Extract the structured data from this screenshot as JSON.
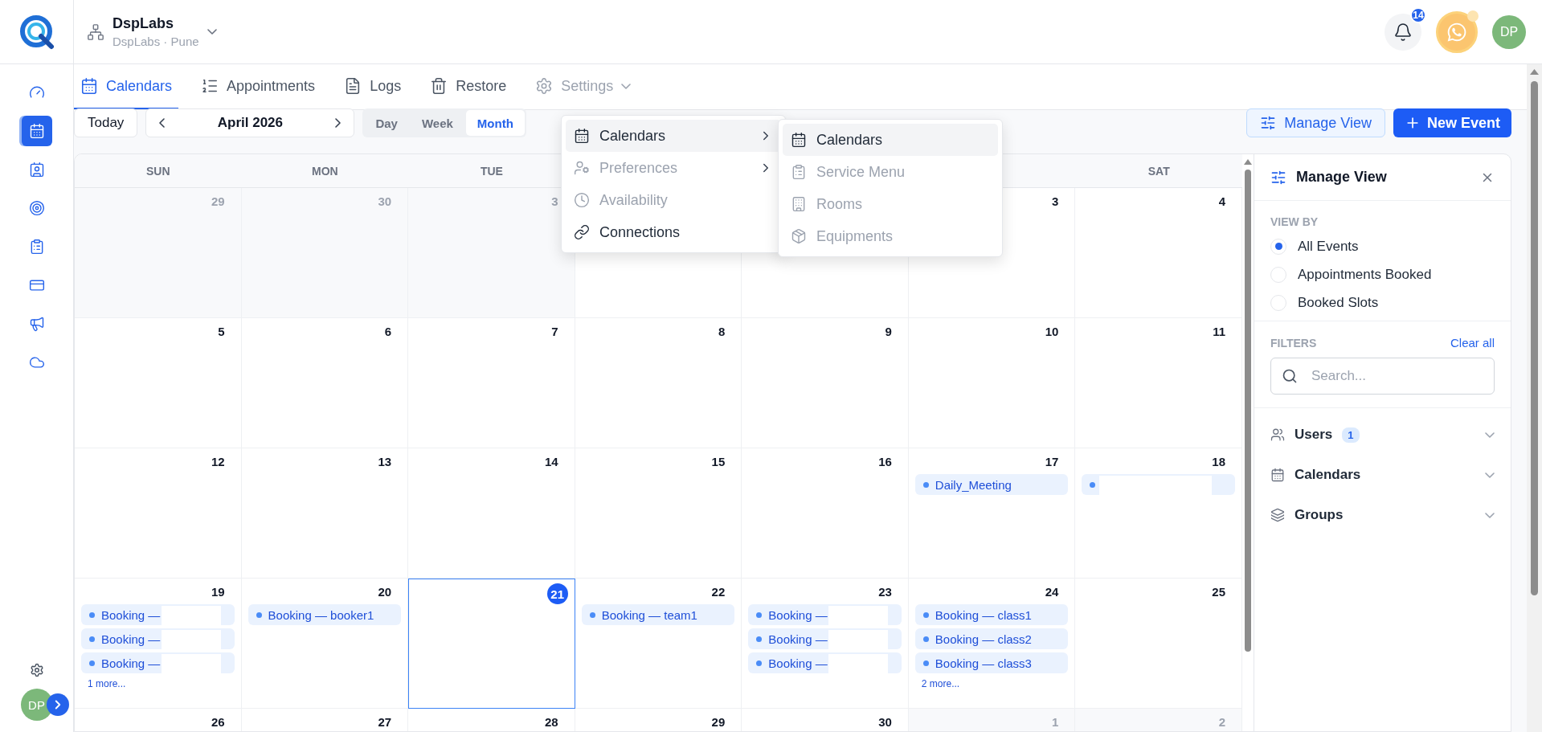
{
  "brand": {
    "org": "DspLabs",
    "location": "DspLabs · Pune"
  },
  "header": {
    "notification_count": "14",
    "avatar": "DP"
  },
  "sidebar": {
    "items": [
      {
        "kind": "gauge",
        "selected": false
      },
      {
        "kind": "calendar",
        "selected": true
      },
      {
        "kind": "contacts",
        "selected": false
      },
      {
        "kind": "target",
        "selected": false
      },
      {
        "kind": "clipboard",
        "selected": false
      },
      {
        "kind": "card",
        "selected": false
      },
      {
        "kind": "megaphone",
        "selected": false
      },
      {
        "kind": "cloud",
        "selected": false
      }
    ],
    "avatar": "DP"
  },
  "tabs": [
    {
      "label": "Calendars",
      "kind": "calendar",
      "selected": true
    },
    {
      "label": "Appointments",
      "kind": "list",
      "selected": false
    },
    {
      "label": "Logs",
      "kind": "file",
      "selected": false
    },
    {
      "label": "Restore",
      "kind": "trash",
      "selected": false
    },
    {
      "label": "Settings",
      "kind": "settings",
      "selected": false
    }
  ],
  "toolbar": {
    "today": "Today",
    "month": "April 2026",
    "views": [
      {
        "label": "Day",
        "selected": false
      },
      {
        "label": "Week",
        "selected": false
      },
      {
        "label": "Month",
        "selected": true
      }
    ],
    "manage_view": "Manage View",
    "new_event": "New Event"
  },
  "settings_menu": {
    "items": [
      {
        "label": "Calendars",
        "kind": "calendar",
        "selected": true,
        "disabled": false,
        "submenu": true
      },
      {
        "label": "Preferences",
        "kind": "preferences",
        "selected": false,
        "disabled": true,
        "submenu": true
      },
      {
        "label": "Availability",
        "kind": "clock",
        "selected": false,
        "disabled": true,
        "submenu": false
      },
      {
        "label": "Connections",
        "kind": "link",
        "selected": false,
        "disabled": false,
        "submenu": false
      }
    ]
  },
  "calendars_submenu": {
    "items": [
      {
        "label": "Calendars",
        "kind": "calendar",
        "selected": true,
        "disabled": false
      },
      {
        "label": "Service Menu",
        "kind": "clipboard",
        "selected": false,
        "disabled": true
      },
      {
        "label": "Rooms",
        "kind": "building",
        "selected": false,
        "disabled": true
      },
      {
        "label": "Equipments",
        "kind": "box",
        "selected": false,
        "disabled": true
      }
    ]
  },
  "calendar": {
    "weekdays": {
      "sun": "SUN",
      "mon": "MON",
      "tue": "TUE",
      "sat": "SAT"
    },
    "weeks": [
      {
        "days": [
          {
            "day": "29",
            "outside": true,
            "today": false
          },
          {
            "day": "30",
            "outside": true,
            "today": false
          },
          {
            "day": "3",
            "outside": true,
            "today": false
          },
          {
            "today": false
          },
          {
            "today": false
          },
          {
            "day": "3",
            "outside": false,
            "today": false
          },
          {
            "day": "4",
            "outside": false,
            "today": false
          }
        ]
      },
      {
        "days": [
          {
            "day": "5",
            "outside": false,
            "today": false
          },
          {
            "day": "6",
            "outside": false,
            "today": false
          },
          {
            "day": "7",
            "outside": false,
            "today": false
          },
          {
            "day": "8",
            "outside": false,
            "today": false
          },
          {
            "day": "9",
            "outside": false,
            "today": false
          },
          {
            "day": "10",
            "outside": false,
            "today": false
          },
          {
            "day": "11",
            "outside": false,
            "today": false
          }
        ]
      },
      {
        "days": [
          {
            "day": "12",
            "outside": false,
            "today": false
          },
          {
            "day": "13",
            "outside": false,
            "today": false
          },
          {
            "day": "14",
            "outside": false,
            "today": false
          },
          {
            "day": "15",
            "outside": false,
            "today": false
          },
          {
            "day": "16",
            "outside": false,
            "today": false
          },
          {
            "day": "17",
            "outside": false,
            "today": false,
            "events": [
              {
                "title": "Daily_Meeting",
                "redacted": false
              }
            ]
          },
          {
            "day": "18",
            "outside": false,
            "today": false,
            "events": [
              {
                "redacted": true
              }
            ]
          }
        ]
      },
      {
        "days": [
          {
            "day": "19",
            "outside": false,
            "today": false,
            "events": [
              {
                "title": "Booking —",
                "redacted": true
              },
              {
                "title": "Booking —",
                "redacted": true
              },
              {
                "title": "Booking —",
                "redacted": true
              }
            ],
            "more": "1 more..."
          },
          {
            "day": "20",
            "outside": false,
            "today": false,
            "events": [
              {
                "title": "Booking — booker1",
                "redacted": false
              }
            ]
          },
          {
            "day": "21",
            "outside": false,
            "today": true
          },
          {
            "day": "22",
            "outside": false,
            "today": false,
            "events": [
              {
                "title": "Booking — team1",
                "redacted": false
              }
            ]
          },
          {
            "day": "23",
            "outside": false,
            "today": false,
            "events": [
              {
                "title": "Booking —",
                "redacted": true
              },
              {
                "title": "Booking —",
                "redacted": true
              },
              {
                "title": "Booking —",
                "redacted": true
              }
            ]
          },
          {
            "day": "24",
            "outside": false,
            "today": false,
            "events": [
              {
                "title": "Booking — class1",
                "redacted": false
              },
              {
                "title": "Booking — class2",
                "redacted": false
              },
              {
                "title": "Booking — class3",
                "redacted": false
              }
            ],
            "more": "2 more..."
          },
          {
            "day": "25",
            "outside": false,
            "today": false
          }
        ]
      },
      {
        "days": [
          {
            "day": "26",
            "outside": false,
            "today": false
          },
          {
            "day": "27",
            "outside": false,
            "today": false
          },
          {
            "day": "28",
            "outside": false,
            "today": false
          },
          {
            "day": "29",
            "outside": false,
            "today": false
          },
          {
            "day": "30",
            "outside": false,
            "today": false
          },
          {
            "day": "1",
            "outside": true,
            "today": false
          },
          {
            "day": "2",
            "outside": true,
            "today": false
          }
        ]
      }
    ]
  },
  "manage_panel": {
    "title": "Manage View",
    "view_by": "VIEW BY",
    "options": [
      {
        "label": "All Events",
        "selected": true
      },
      {
        "label": "Appointments Booked",
        "selected": false
      },
      {
        "label": "Booked Slots",
        "selected": false
      }
    ],
    "filters_label": "FILTERS",
    "clear_all": "Clear all",
    "search": {
      "placeholder": "Search..."
    },
    "filters": [
      {
        "label": "Users",
        "kind": "users",
        "count": "1"
      },
      {
        "label": "Calendars",
        "kind": "calendar"
      },
      {
        "label": "Groups",
        "kind": "layers"
      }
    ]
  }
}
